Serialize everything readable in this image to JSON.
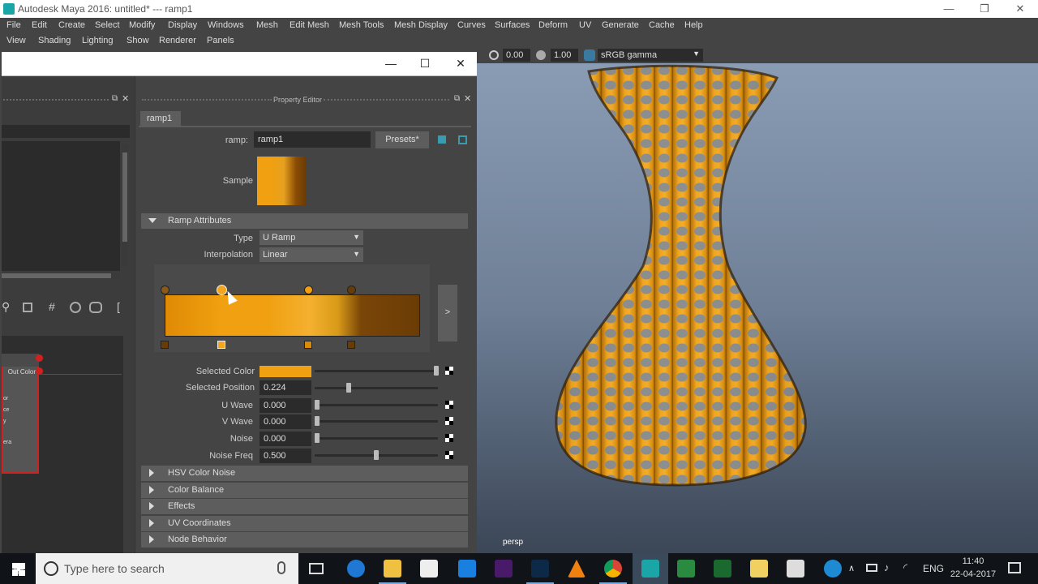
{
  "titlebar": {
    "title": "Autodesk Maya 2016: untitled*   ---   ramp1",
    "minimize": "—",
    "restore": "❐",
    "close": "✕"
  },
  "menu_main": [
    "File",
    "Edit",
    "Create",
    "Select",
    "Modify",
    "Display",
    "Windows",
    "Mesh",
    "Edit Mesh",
    "Mesh Tools",
    "Mesh Display",
    "Curves",
    "Surfaces",
    "Deform",
    "UV",
    "Generate",
    "Cache",
    "Help"
  ],
  "menu_panel": [
    "View",
    "Shading",
    "Lighting",
    "Show",
    "Renderer",
    "Panels"
  ],
  "viewport_toolbar": {
    "exposure": "0.00",
    "gamma": "1.00",
    "color_space": "sRGB gamma"
  },
  "float_window": {
    "minimize": "—",
    "maximize": "☐",
    "close": "✕"
  },
  "left_panel": {
    "node_port_label": "Out Color",
    "node_attrs": [
      "or",
      "ce",
      "y",
      "era"
    ]
  },
  "property_editor": {
    "header": "Property Editor",
    "tab": "ramp1",
    "ramp_label": "ramp:",
    "ramp_name": "ramp1",
    "presets": "Presets*",
    "sample_label": "Sample",
    "ramp_attributes": "Ramp Attributes",
    "type_label": "Type",
    "type_value": "U Ramp",
    "interp_label": "Interpolation",
    "interp_value": "Linear",
    "expand_button": ">",
    "selected_color_label": "Selected Color",
    "selected_position_label": "Selected Position",
    "selected_position_value": "0.224",
    "u_wave_label": "U Wave",
    "u_wave_value": "0.000",
    "v_wave_label": "V Wave",
    "v_wave_value": "0.000",
    "noise_label": "Noise",
    "noise_value": "0.000",
    "noise_freq_label": "Noise Freq",
    "noise_freq_value": "0.500",
    "sections": [
      "HSV Color Noise",
      "Color Balance",
      "Effects",
      "UV Coordinates",
      "Node Behavior"
    ]
  },
  "viewport": {
    "camera": "persp"
  },
  "taskbar": {
    "search_placeholder": "Type here to search",
    "language": "ENG",
    "time": "11:40",
    "date": "22-04-2017"
  },
  "colors": {
    "ramp_orange": "#f0a010",
    "ramp_dark": "#6a3c05",
    "maya_bg": "#444444"
  }
}
